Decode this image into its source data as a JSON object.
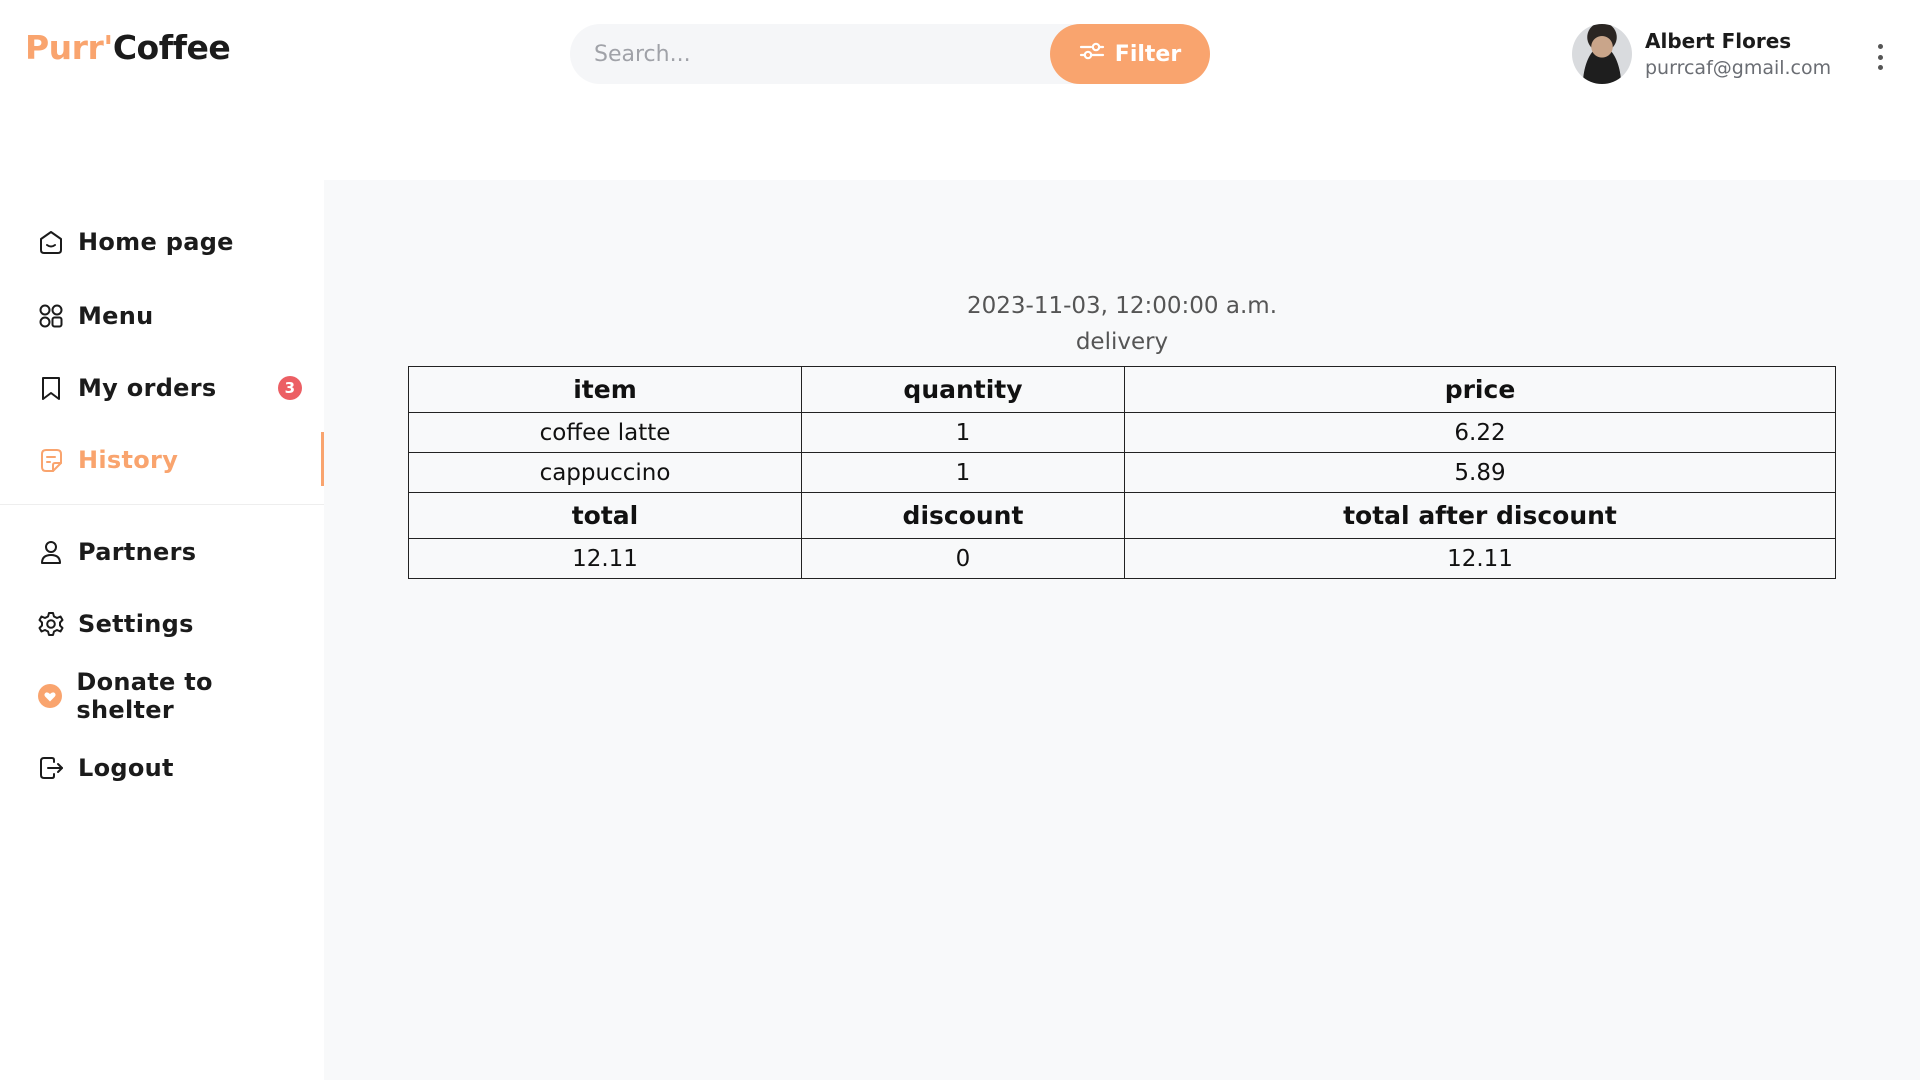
{
  "brand": {
    "part1": "Purr'",
    "part2": "Coffee",
    "accent": "#f9a46e"
  },
  "search": {
    "placeholder": "Search...",
    "value": ""
  },
  "filter": {
    "label": "Filter",
    "icon": "sliders-icon"
  },
  "user": {
    "name": "Albert Flores",
    "email": "purrcaf@gmail.com"
  },
  "sidebar": {
    "items": [
      {
        "label": "Home page",
        "icon": "home-icon"
      },
      {
        "label": "Menu",
        "icon": "grid-icon"
      },
      {
        "label": "My orders",
        "icon": "bookmark-icon",
        "badge": "3"
      },
      {
        "label": "History",
        "icon": "document-icon",
        "active": true
      },
      {
        "label": "Partners",
        "icon": "user-icon"
      },
      {
        "label": "Settings",
        "icon": "gear-icon"
      },
      {
        "label": "Donate to shelter",
        "icon": "heart-icon"
      },
      {
        "label": "Logout",
        "icon": "logout-icon"
      }
    ]
  },
  "order": {
    "date": "2023-11-03, 12:00:00 a.m.",
    "type": "delivery",
    "headers": [
      "item",
      "quantity",
      "price"
    ],
    "rows": [
      [
        "coffee latte",
        "1",
        "6.22"
      ],
      [
        "cappuccino",
        "1",
        "5.89"
      ]
    ],
    "summary_headers": [
      "total",
      "discount",
      "total after discount"
    ],
    "summary_values": [
      "12.11",
      "0",
      "12.11"
    ]
  },
  "colors": {
    "accent": "#f9a46e",
    "badge": "#ec5f64",
    "main_bg": "#f8f9fa"
  }
}
